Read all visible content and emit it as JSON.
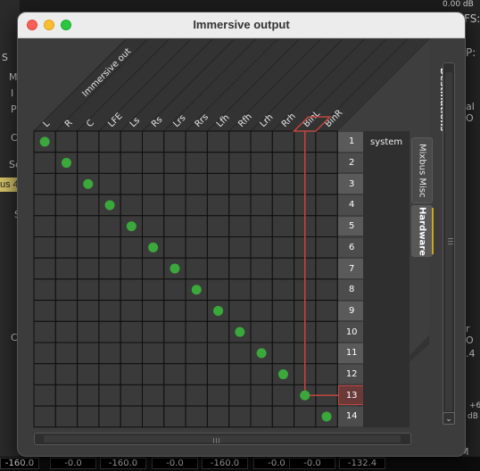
{
  "window": {
    "title": "Immersive output"
  },
  "matrix": {
    "corner_label": "Immersive out",
    "columns": [
      "L",
      "R",
      "C",
      "LFE",
      "Ls",
      "Rs",
      "Lrs",
      "Rrs",
      "Lfh",
      "Rfh",
      "Lrh",
      "Rrh",
      "BinL",
      "BinR"
    ],
    "rows": [
      "1",
      "2",
      "3",
      "4",
      "5",
      "6",
      "7",
      "8",
      "9",
      "10",
      "11",
      "12",
      "13",
      "14"
    ],
    "connections": [
      [
        0,
        0
      ],
      [
        1,
        1
      ],
      [
        2,
        2
      ],
      [
        3,
        3
      ],
      [
        4,
        4
      ],
      [
        5,
        5
      ],
      [
        6,
        6
      ],
      [
        7,
        7
      ],
      [
        8,
        8
      ],
      [
        9,
        9
      ],
      [
        10,
        10
      ],
      [
        11,
        11
      ],
      [
        12,
        12
      ],
      [
        13,
        13
      ]
    ],
    "highlight": {
      "column": 12,
      "row": 12
    },
    "bundle_label": "system",
    "colors": {
      "connection": "#3aa83a",
      "highlight": "#c0453e",
      "grid_line": "#0e0e0e"
    }
  },
  "side_tabs": {
    "heading": "Destinations",
    "tabs": [
      {
        "label": "Mixbus Misc",
        "active": false
      },
      {
        "label": "Hardware",
        "active": true
      }
    ]
  },
  "background": {
    "left_fragments": [
      "S",
      "M",
      "I",
      "P",
      "C",
      "Se",
      "us 4",
      "S",
      "C"
    ],
    "right_fragments": [
      "0.00 dB",
      "FS:",
      "P:",
      "al O",
      "r O",
      ".4",
      "+6",
      "dB",
      "M"
    ],
    "meter_values": [
      "-160.0",
      "-0.0",
      "-160.0",
      "-0.0",
      "-160.0",
      "-0.0",
      "-0.0",
      "-132.4"
    ]
  }
}
